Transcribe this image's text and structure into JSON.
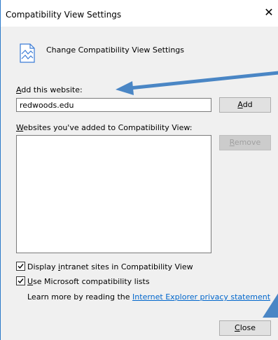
{
  "window": {
    "title": "Compatibility View Settings",
    "close_glyph": "✕"
  },
  "header": {
    "text": "Change Compatibility View Settings",
    "icon": "compatibility-page-icon"
  },
  "add_site": {
    "label_underlined": "A",
    "label_rest": "dd this website:",
    "value": "redwoods.edu",
    "button_underlined": "A",
    "button_rest": "dd"
  },
  "sites_list": {
    "label_underlined": "W",
    "label_rest": "ebsites you've added to Compatibility View:",
    "items": []
  },
  "remove_button": {
    "underlined": "R",
    "rest": "emove",
    "enabled": false
  },
  "options": {
    "intranet": {
      "before": "Display ",
      "underlined": "i",
      "after": "ntranet sites in Compatibility View",
      "checked": true
    },
    "ms_lists": {
      "underlined": "U",
      "after": "se Microsoft compatibility lists",
      "checked": true
    }
  },
  "learn_more": {
    "text": "Learn more by reading the ",
    "link": "Internet Explorer privacy statement"
  },
  "close_button": {
    "underlined": "C",
    "rest": "lose"
  },
  "colors": {
    "annotation_arrow": "#4a86c5",
    "link": "#0066cc",
    "accent_border": "#2b79c9"
  }
}
